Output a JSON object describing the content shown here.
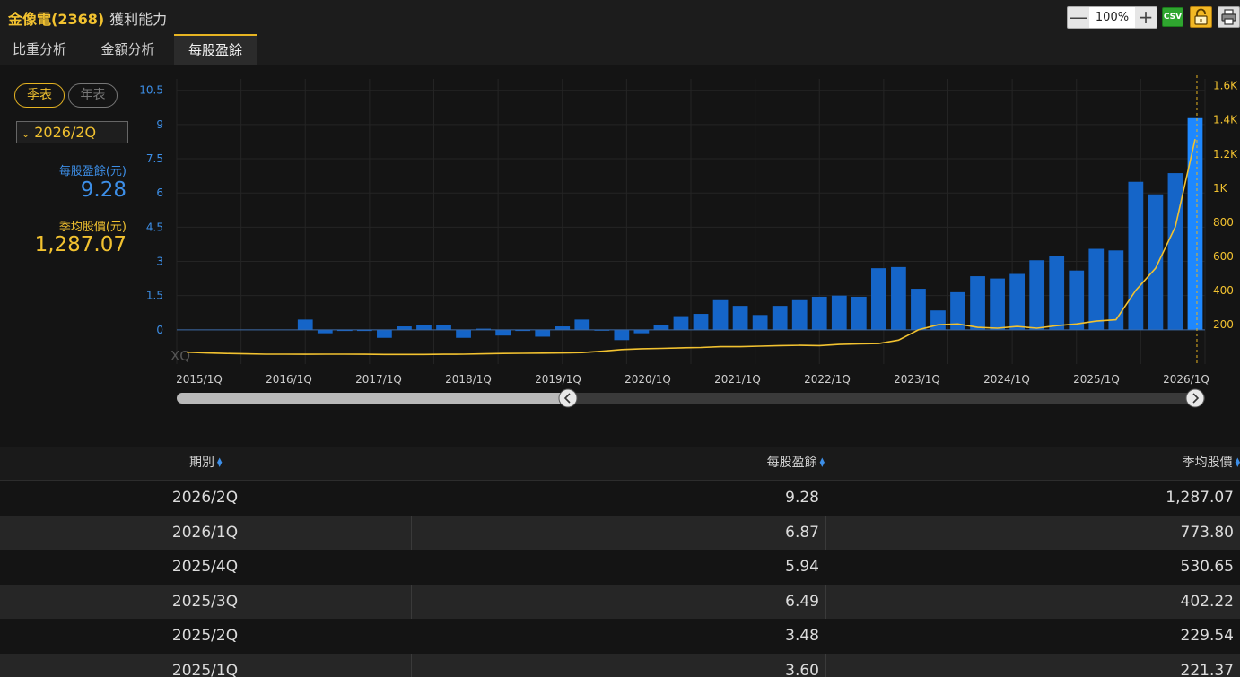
{
  "header": {
    "stock": "金像電(2368)",
    "section": "獲利能力",
    "zoom_minus": "—",
    "zoom_value": "100%",
    "zoom_plus": "+",
    "csv_label": "CSV"
  },
  "tabs": [
    {
      "label": "比重分析"
    },
    {
      "label": "金額分析"
    },
    {
      "label": "每股盈餘"
    }
  ],
  "sidebar": {
    "quarterly": "季表",
    "annual": "年表",
    "period_selected": "2026/2Q",
    "eps_label": "每股盈餘(元)",
    "eps_value": "9.28",
    "price_label": "季均股價(元)",
    "price_value": "1,287.07"
  },
  "chart_data": {
    "type": "bar",
    "watermark": "XQ",
    "x_ticks": [
      "2015/1Q",
      "2016/1Q",
      "2017/1Q",
      "2018/1Q",
      "2019/1Q",
      "2020/1Q",
      "2021/1Q",
      "2022/1Q",
      "2023/1Q",
      "2024/1Q",
      "2025/1Q",
      "2026/1Q"
    ],
    "y_left_ticks": [
      "0",
      "1.5",
      "3",
      "4.5",
      "6",
      "7.5",
      "9",
      "10.5"
    ],
    "y_left_range": [
      -1.5,
      11
    ],
    "y_right_ticks": [
      "200",
      "400",
      "600",
      "800",
      "1K",
      "1.2K",
      "1.4K",
      "1.6K"
    ],
    "y_right_values": [
      200,
      400,
      600,
      800,
      1000,
      1200,
      1400,
      1600
    ],
    "y_right_range": [
      -30,
      1640
    ],
    "colors": {
      "eps": "#1565c8",
      "eps_selected": "#1e88ff",
      "price": "#f2c230"
    },
    "series": [
      {
        "key": "eps",
        "values": [
          0.45,
          -0.15,
          -0.05,
          -0.05,
          -0.35,
          0.15,
          0.2,
          0.2,
          -0.35,
          0.05,
          -0.25,
          -0.05,
          -0.3,
          0.15,
          0.45,
          0.0,
          -0.45,
          -0.15,
          0.2,
          0.6,
          0.7,
          1.3,
          1.05,
          0.65,
          1.05,
          1.3,
          1.45,
          1.5,
          1.45,
          2.7,
          2.75,
          1.8,
          0.85,
          1.65,
          2.35,
          2.25,
          2.45,
          3.05,
          3.25,
          2.6,
          3.55,
          3.48,
          6.49,
          5.94,
          6.87,
          9.28
        ]
      },
      {
        "key": "price",
        "values": [
          40,
          35,
          32,
          30,
          28,
          28,
          27,
          28,
          28,
          27,
          26,
          26,
          26,
          27,
          28,
          30,
          32,
          33,
          34,
          35,
          37,
          45,
          55,
          60,
          62,
          65,
          67,
          72,
          72,
          75,
          78,
          80,
          78,
          85,
          88,
          90,
          110,
          170,
          200,
          205,
          185,
          180,
          190,
          180,
          195,
          205,
          221.37,
          229.54,
          402.22,
          530.65,
          773.8,
          1287.07
        ]
      }
    ]
  },
  "table": {
    "headers": [
      "期別",
      "每股盈餘",
      "季均股價"
    ],
    "rows": [
      [
        "2026/2Q",
        "9.28",
        "1,287.07"
      ],
      [
        "2026/1Q",
        "6.87",
        "773.80"
      ],
      [
        "2025/4Q",
        "5.94",
        "530.65"
      ],
      [
        "2025/3Q",
        "6.49",
        "402.22"
      ],
      [
        "2025/2Q",
        "3.48",
        "229.54"
      ],
      [
        "2025/1Q",
        "3.60",
        "221.37"
      ]
    ]
  }
}
